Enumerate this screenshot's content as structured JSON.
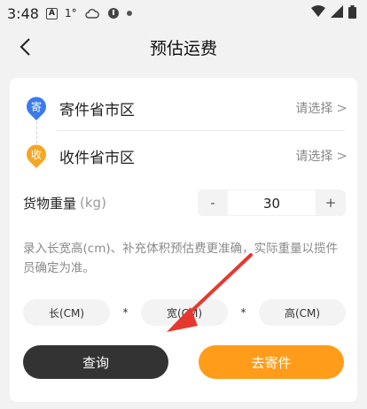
{
  "status_bar": {
    "time": "3:48",
    "icons": [
      "a-box-icon",
      "temperature-icon",
      "weather-icon",
      "battery-saver-icon",
      "dot-icon",
      "wifi-icon",
      "signal-icon",
      "battery-icon"
    ]
  },
  "nav": {
    "title": "预估运费",
    "back_icon": "chevron-left-icon"
  },
  "sender": {
    "badge": "寄",
    "badge_color": "#3a7bea",
    "label": "寄件省市区",
    "action": "请选择",
    "chevron": ">"
  },
  "receiver": {
    "badge": "收",
    "badge_color": "#f5a623",
    "label": "收件省市区",
    "action": "请选择",
    "chevron": ">"
  },
  "weight": {
    "label": "货物重量",
    "unit": "(kg)",
    "minus": "-",
    "value": "30",
    "plus": "+"
  },
  "hint": "录入长宽高(cm)、补充体积预估费更准确，实际重量以揽件员确定为准。",
  "dimensions": {
    "length_placeholder": "长(CM)",
    "width_placeholder": "宽(CM)",
    "height_placeholder": "高(CM)",
    "separator": "*"
  },
  "buttons": {
    "query": "查询",
    "send": "去寄件"
  },
  "colors": {
    "accent": "#ff9c1a",
    "dark_button": "#333333",
    "annotation_arrow": "#e5392f"
  }
}
